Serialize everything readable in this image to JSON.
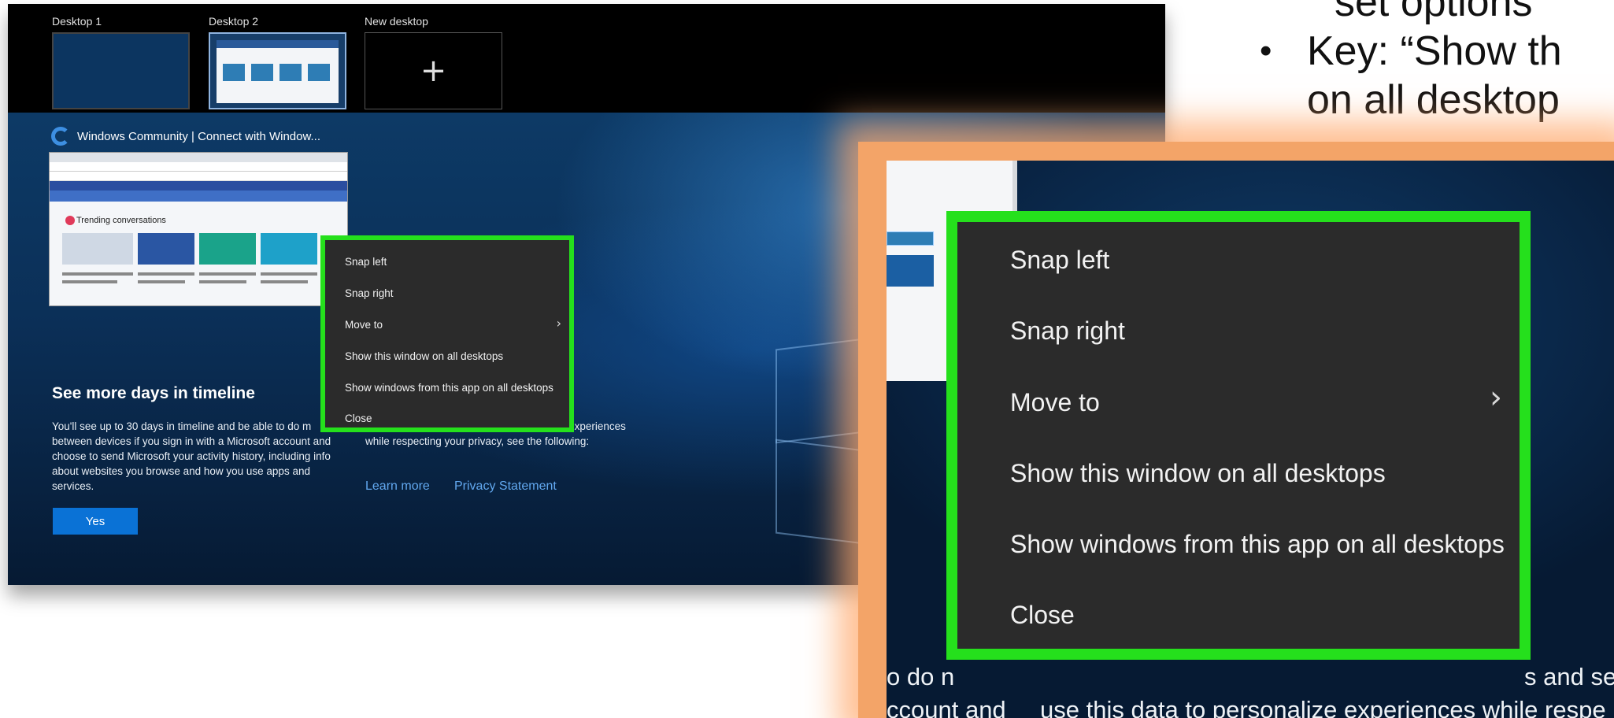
{
  "slide": {
    "line1": "set options",
    "line2": "Key: “Show th",
    "line3": "on all desktop",
    "bullet": "•"
  },
  "task_view": {
    "desktops": [
      {
        "label": "Desktop 1"
      },
      {
        "label": "Desktop 2"
      },
      {
        "label": "New desktop",
        "icon": "plus-icon",
        "glyph": "+"
      }
    ],
    "window_title": "Windows Community | Connect with Window...",
    "thumbnail_section": "Trending conversations"
  },
  "timeline": {
    "heading": "See more days in timeline",
    "body_left": "You'll see up to 30 days in timeline and be able to do m between devices if you sign in with a Microsoft account and choose to send Microsoft your activity history, including info about websites you browse and how you use apps and services.",
    "body_right": "s and services use this data to personalize experiences while respecting your privacy, see the following:",
    "learn_more": "Learn more",
    "privacy": "Privacy Statement",
    "yes_button": "Yes"
  },
  "context_menu": {
    "items": [
      {
        "label": "Snap left"
      },
      {
        "label": "Snap right"
      },
      {
        "label": "Move to",
        "has_submenu": true
      },
      {
        "label": "Show this window on all desktops"
      },
      {
        "label": "Show windows from this app on all desktops"
      },
      {
        "label": "Close"
      }
    ],
    "chevron": "›",
    "highlight_color": "#25e01c"
  },
  "zoom_footer": {
    "left_top": "o do n",
    "right_top": "s and se",
    "left_bottom": "ccount and",
    "right_bottom": "use this data to personalize experiences while respe"
  },
  "colors": {
    "accent": "#0a72d6",
    "link": "#62a8ef",
    "menu_bg": "#2b2b2b",
    "halo": "#f3a468"
  }
}
